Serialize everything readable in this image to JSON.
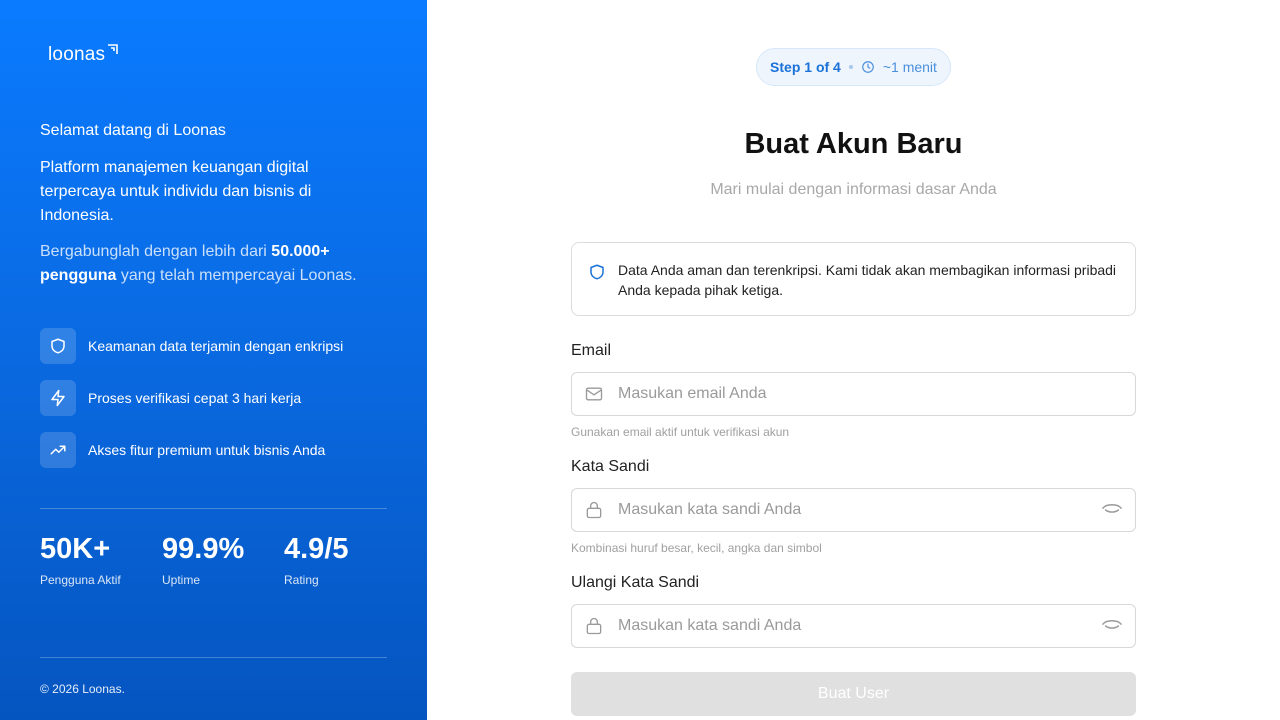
{
  "brand": {
    "name": "loonas"
  },
  "left": {
    "welcome": "Selamat datang di Loonas",
    "description": "Platform manajemen keuangan digital terpercaya untuk individu dan bisnis di Indonesia.",
    "join_prefix": "Bergabunglah dengan lebih dari ",
    "join_highlight": "50.000+ pengguna",
    "join_suffix": " yang telah mempercayai Loonas.",
    "features": [
      {
        "icon": "shield-icon",
        "label": "Keamanan data terjamin dengan enkripsi"
      },
      {
        "icon": "lightning-icon",
        "label": "Proses verifikasi cepat 3 hari kerja"
      },
      {
        "icon": "trending-up-icon",
        "label": "Akses fitur premium untuk bisnis Anda"
      }
    ],
    "stats": [
      {
        "value": "50K+",
        "label": "Pengguna Aktif"
      },
      {
        "value": "99.9%",
        "label": "Uptime"
      },
      {
        "value": "4.9/5",
        "label": "Rating"
      }
    ],
    "copyright": "© 2026 Loonas."
  },
  "form": {
    "step": "Step 1 of 4",
    "time": "~1 menit",
    "title": "Buat Akun Baru",
    "subtitle": "Mari mulai dengan informasi dasar Anda",
    "notice": "Data Anda aman dan terenkripsi. Kami tidak akan membagikan informasi pribadi Anda kepada pihak ketiga.",
    "email": {
      "label": "Email",
      "placeholder": "Masukan email Anda",
      "hint": "Gunakan email aktif untuk verifikasi akun"
    },
    "password": {
      "label": "Kata Sandi",
      "placeholder": "Masukan kata sandi Anda",
      "hint": "Kombinasi huruf besar, kecil, angka dan simbol"
    },
    "confirm": {
      "label": "Ulangi Kata Sandi",
      "placeholder": "Masukan kata sandi Anda"
    },
    "submit_label": "Buat User"
  },
  "colors": {
    "accent": "#0a7bff",
    "disabled": "#e0e0e0"
  }
}
